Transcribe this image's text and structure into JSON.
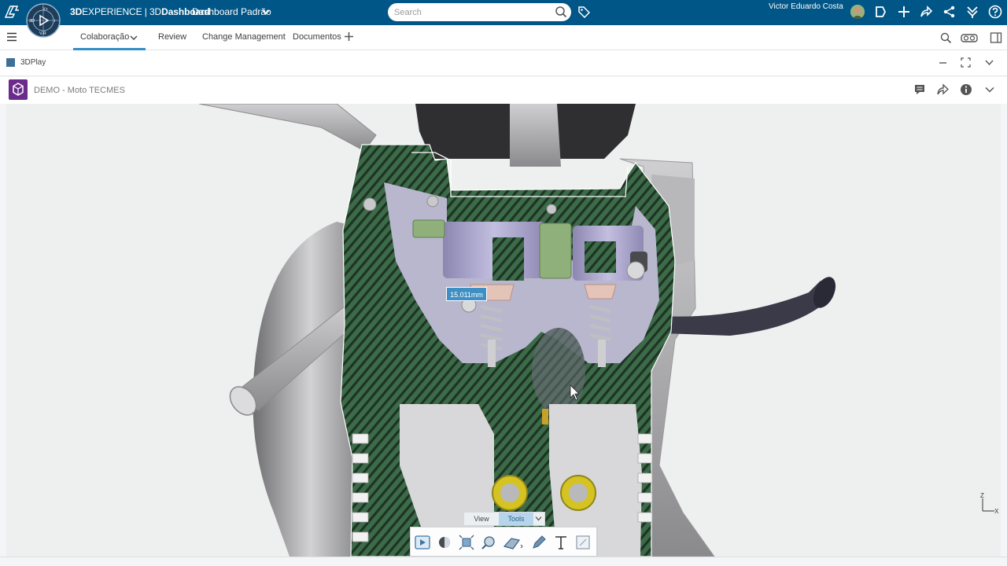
{
  "topbar": {
    "brand_prefix": "3D",
    "brand_middle": "EXPERIENCE | 3D",
    "brand_suffix": "Dashboard",
    "dashboard_name": "Dashboard Padrão",
    "search_placeholder": "Search",
    "user_name": "Victor Eduardo Costa",
    "compass_labels": {
      "top": "V+",
      "left": "3D",
      "right": "i",
      "bottom": "V.R"
    }
  },
  "tabs": {
    "items": [
      {
        "label": "Colaboração",
        "active": true
      },
      {
        "label": "Review",
        "active": false
      },
      {
        "label": "Change Management",
        "active": false
      },
      {
        "label": "Documentos",
        "active": false
      }
    ]
  },
  "widget": {
    "title": "3DPlay"
  },
  "document": {
    "title": "DEMO - Moto TECMES"
  },
  "viewer": {
    "measurement_label": "15.011mm",
    "axis_z": "Z",
    "axis_x": "X"
  },
  "actionbar": {
    "tabs": [
      {
        "label": "View",
        "active": false
      },
      {
        "label": "Tools",
        "active": true
      }
    ]
  },
  "colors": {
    "topbar": "#005686",
    "accent": "#368ec4",
    "section_fill": "#2f5a3c",
    "document_icon": "#6a2b8c"
  }
}
